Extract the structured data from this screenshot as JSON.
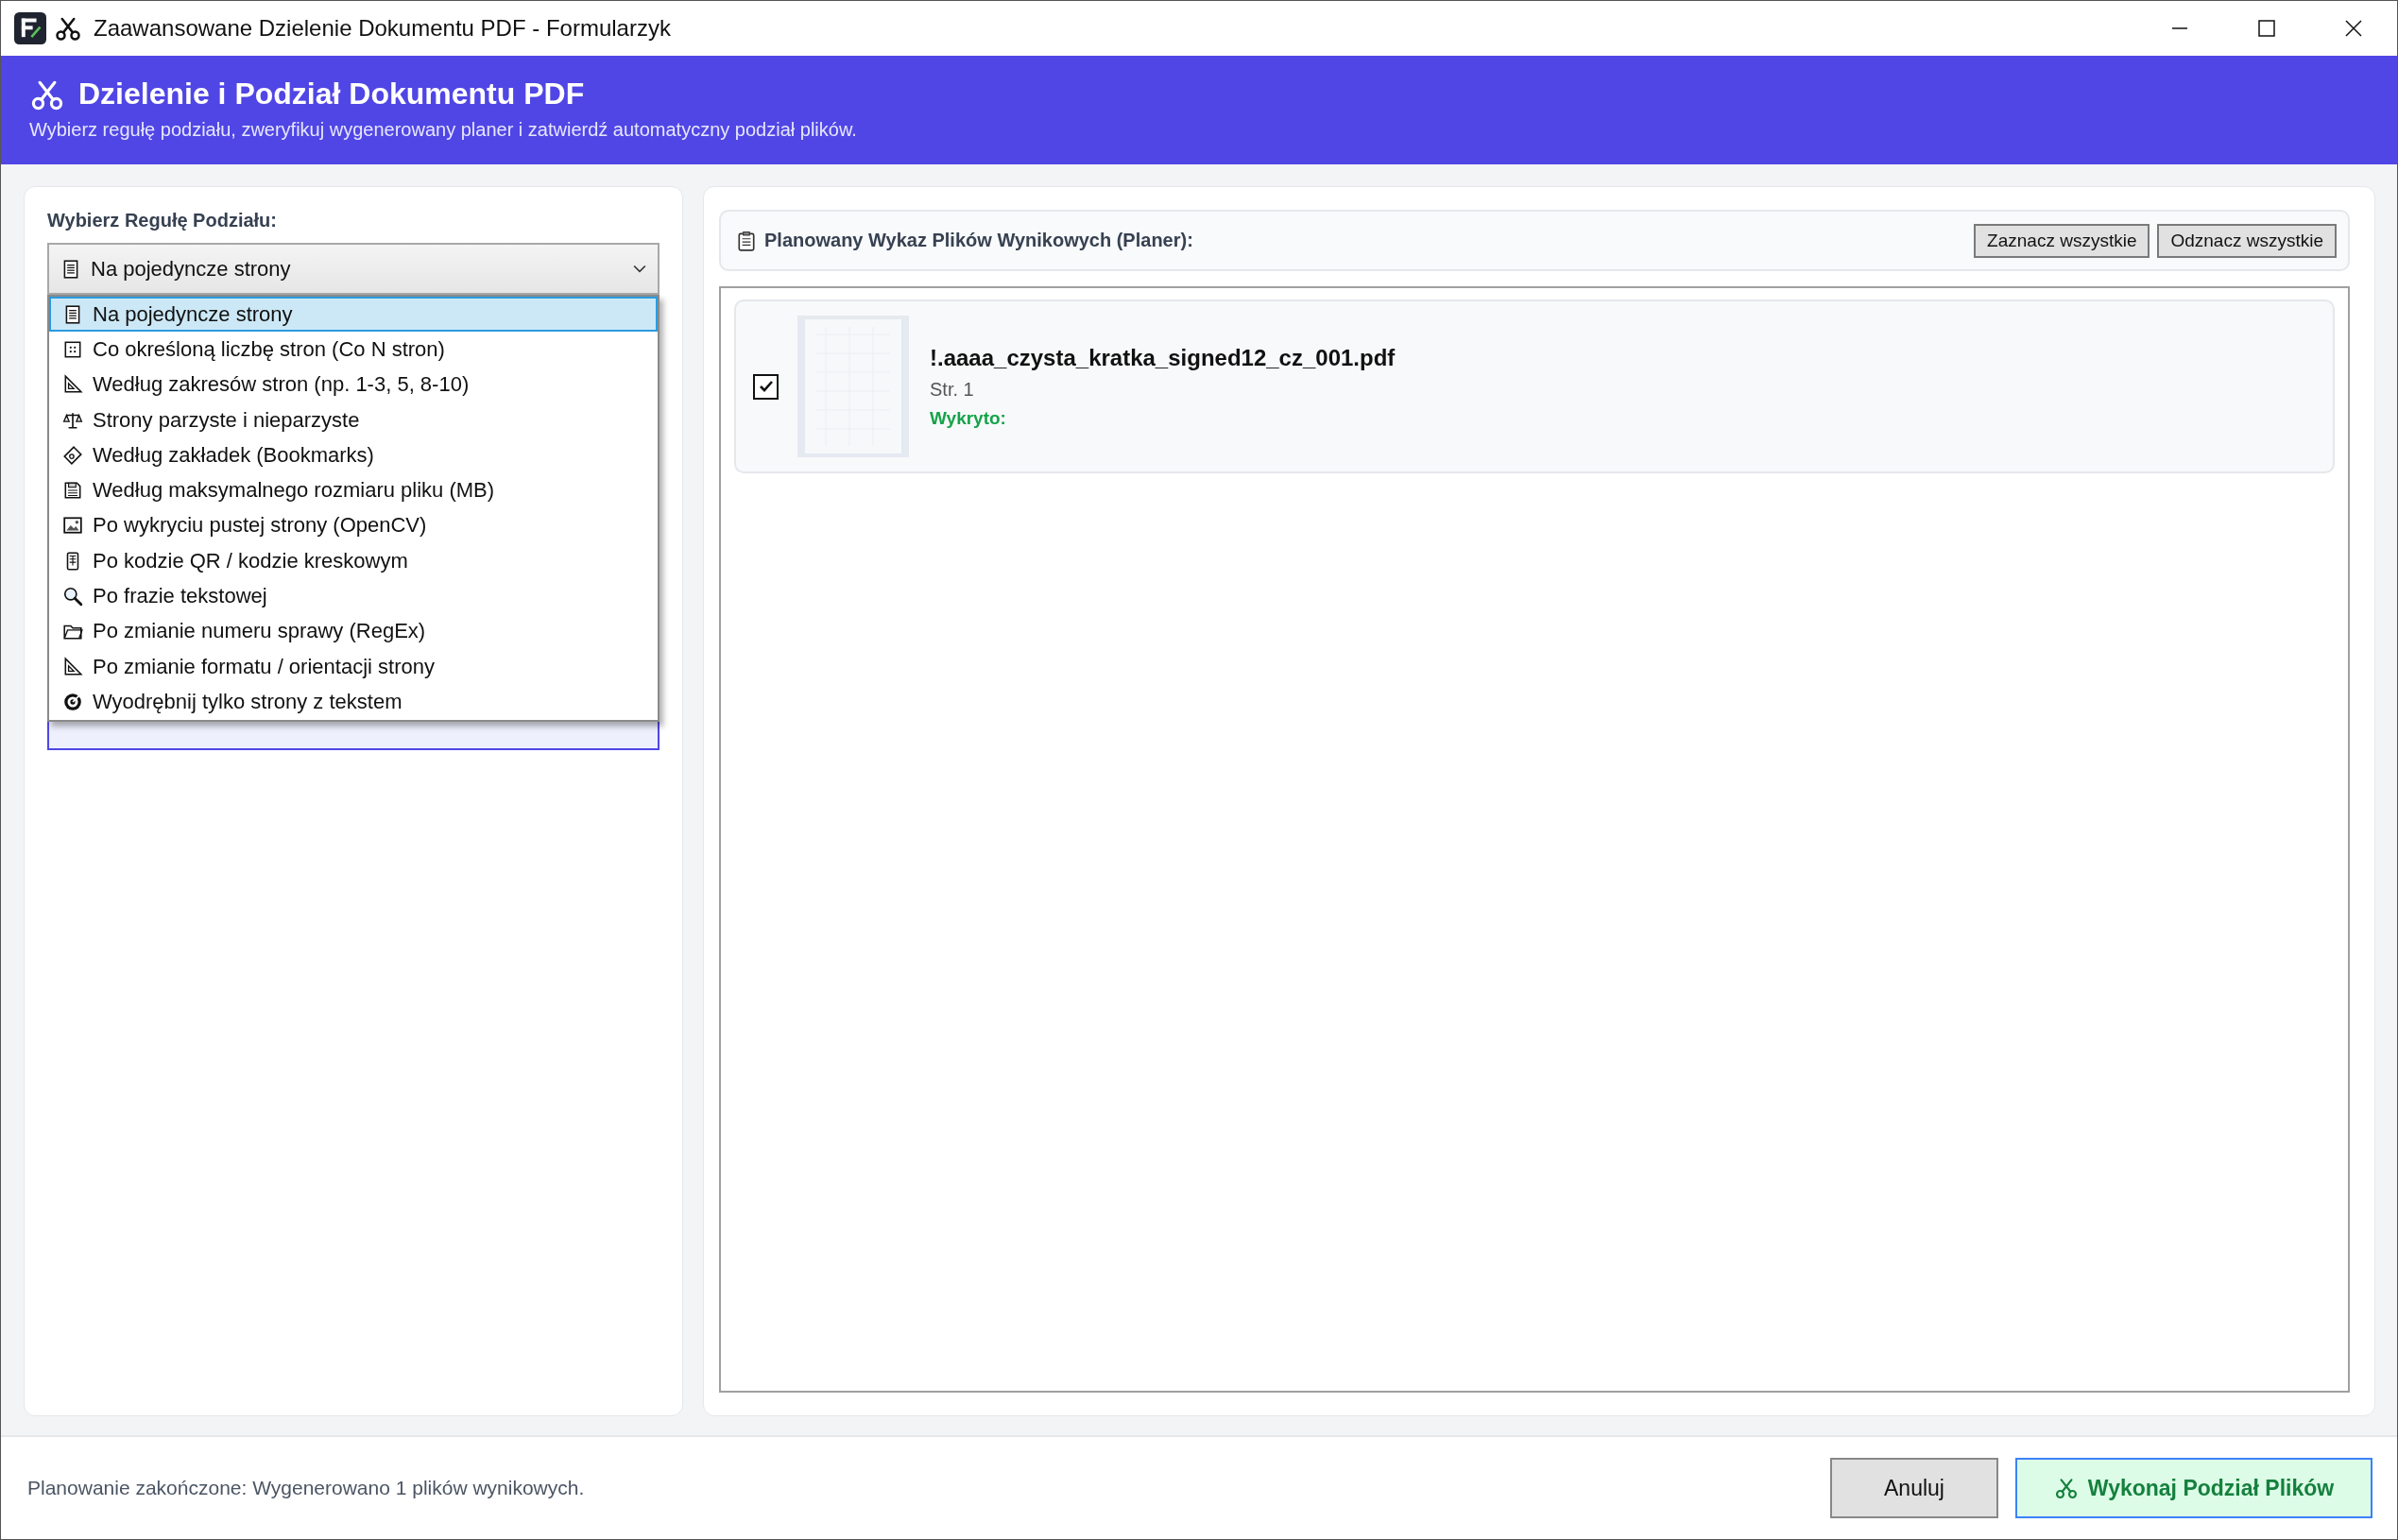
{
  "window": {
    "title": "Zaawansowane Dzielenie Dokumentu PDF - Formularzyk"
  },
  "header": {
    "title": "Dzielenie i Podział Dokumentu PDF",
    "subtitle": "Wybierz regułę podziału, zweryfikuj wygenerowany planer i zatwierdź automatyczny podział plików."
  },
  "rule_picker": {
    "label": "Wybierz Regułę Podziału:",
    "value": "Na pojedyncze strony",
    "options": [
      {
        "label": "Na pojedyncze strony",
        "kind": "single",
        "selected": true
      },
      {
        "label": "Co określoną liczbę stron (Co N stron)",
        "kind": "count",
        "selected": false
      },
      {
        "label": "Według zakresów stron (np. 1-3, 5, 8-10)",
        "kind": "range",
        "selected": false
      },
      {
        "label": "Strony parzyste i nieparzyste",
        "kind": "parity",
        "selected": false
      },
      {
        "label": "Według zakładek (Bookmarks)",
        "kind": "bookmark",
        "selected": false
      },
      {
        "label": "Według maksymalnego rozmiaru pliku (MB)",
        "kind": "size",
        "selected": false
      },
      {
        "label": "Po wykryciu pustej strony (OpenCV)",
        "kind": "blank",
        "selected": false
      },
      {
        "label": "Po kodzie QR / kodzie kreskowym",
        "kind": "qr",
        "selected": false
      },
      {
        "label": "Po frazie tekstowej",
        "kind": "text",
        "selected": false
      },
      {
        "label": "Po zmianie numeru sprawy (RegEx)",
        "kind": "regex",
        "selected": false
      },
      {
        "label": "Po zmianie formatu / orientacji strony",
        "kind": "format",
        "selected": false
      },
      {
        "label": "Wyodrębnij tylko strony z tekstem",
        "kind": "extract",
        "selected": false
      }
    ]
  },
  "planner": {
    "title": "Planowany Wykaz Plików Wynikowych (Planer):",
    "buttons": [
      "Zaznacz wszystkie",
      "Odznacz wszystkie"
    ],
    "files": [
      {
        "name": "!.aaaa_czysta_kratka_signed12_cz_001.pdf",
        "pages": "Str. 1",
        "detected": "Wykryto:",
        "checked": true
      }
    ]
  },
  "status_bar": {
    "message": "Planowanie zakończone: Wygenerowano 1 plików wynikowych.",
    "buttons": [
      {
        "label": "Anuluj",
        "kind": "cancel"
      },
      {
        "label": "Wykonaj Podział Plików",
        "kind": "primary"
      }
    ]
  }
}
